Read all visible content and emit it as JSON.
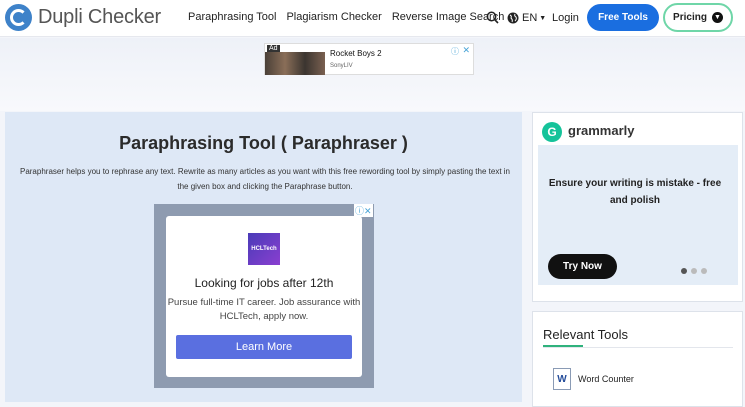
{
  "brand": {
    "name": "Dupli Checker",
    "logo_color": "#3e82c9"
  },
  "nav": {
    "items": [
      "Paraphrasing Tool",
      "Plagiarism Checker",
      "Reverse Image Search"
    ],
    "language": "EN",
    "login": "Login",
    "free_tools": "Free Tools",
    "pricing": "Pricing"
  },
  "top_ad": {
    "badge": "Ad",
    "title": "Rocket Boys 2",
    "source": "SonyLIV"
  },
  "main": {
    "title": "Paraphrasing Tool ( Paraphraser )",
    "description": "Paraphraser helps you to rephrase any text. Rewrite as many articles as you want with this free rewording tool by simply pasting the text in the given box and clicking the Paraphrase button."
  },
  "content_ad": {
    "logo_text": "HCLTech",
    "headline": "Looking for jobs after 12th",
    "body": "Pursue full-time IT career. Job assurance with HCLTech, apply now.",
    "cta": "Learn More"
  },
  "grammarly": {
    "name": "grammarly",
    "headline": "Ensure your writing is mistake - free and polish",
    "cta": "Try Now",
    "accent": "#15c39a"
  },
  "relevant_tools": {
    "title": "Relevant Tools",
    "items": [
      {
        "label": "Word Counter",
        "icon": "word-doc-icon"
      }
    ]
  },
  "colors": {
    "primary": "#1a6ee0",
    "panel": "#dee8f6",
    "pricing_border": "#6fd6a8"
  }
}
